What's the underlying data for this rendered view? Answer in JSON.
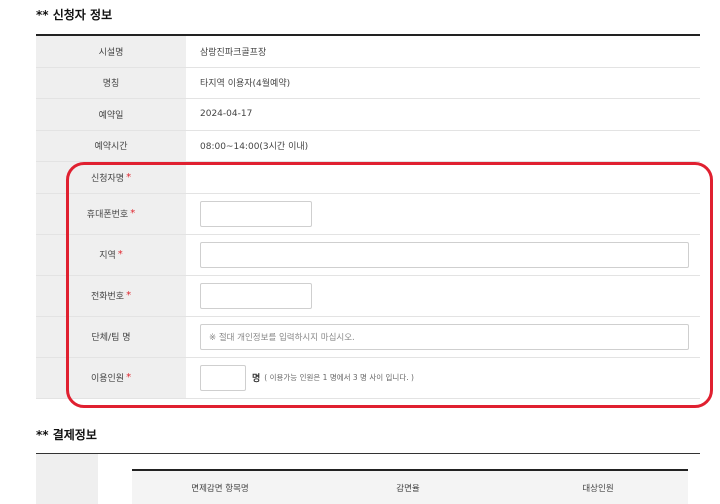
{
  "sections": {
    "applicant_title": "** 신청자 정보",
    "payment_title": "** 결제정보"
  },
  "facility": {
    "label": "시설명",
    "value": "삼랑진파크골프장"
  },
  "name_row": {
    "label": "명칭",
    "value": "타지역 이용자(4월예약)"
  },
  "date_row": {
    "label": "예약일",
    "value": "2024-04-17"
  },
  "time_row": {
    "label": "예약시간",
    "value": "08:00~14:00(3시간 이내)"
  },
  "applicant_form": {
    "required_mark": "*",
    "applicant_name": {
      "label": "신청자명",
      "value": ""
    },
    "phone": {
      "label": "휴대폰번호",
      "value": ""
    },
    "region": {
      "label": "지역",
      "value": ""
    },
    "tel": {
      "label": "전화번호",
      "value": ""
    },
    "group": {
      "label": "단체/팀 명",
      "placeholder": "※ 절대 개인정보를 입력하시지 마십시오."
    },
    "headcount": {
      "label": "이용인원",
      "value": "",
      "unit": "명",
      "note": "( 이용가능 인원은 1 명에서 3 명 사이 입니다. )"
    }
  },
  "payment_table": {
    "headers": [
      "면제감면 항목명",
      "감면율",
      "대상인원"
    ]
  },
  "colors": {
    "highlight": "#e02030",
    "required": "#e0262f",
    "label_bg": "#efefef"
  }
}
